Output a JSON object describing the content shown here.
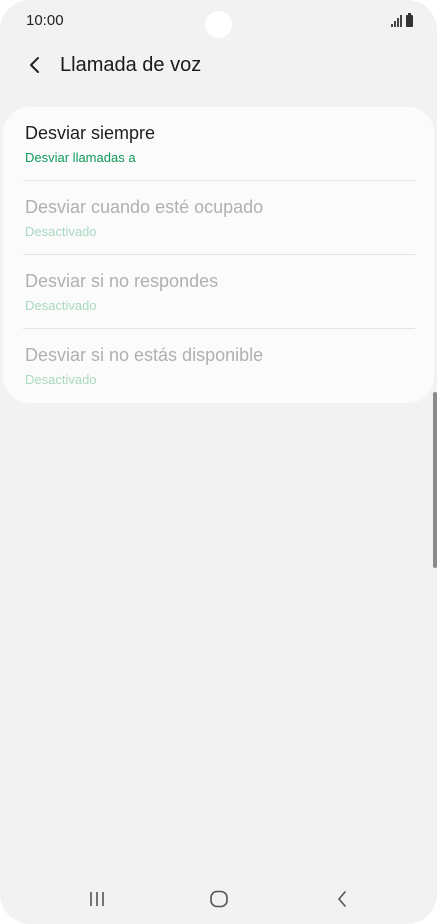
{
  "status_bar": {
    "time": "10:00",
    "icons": [
      "signal-icon",
      "battery-icon"
    ]
  },
  "header": {
    "back_icon": "chevron-left-icon",
    "title": "Llamada de voz"
  },
  "forward_options": [
    {
      "title": "Desviar siempre",
      "subtitle": "Desviar llamadas a",
      "enabled": true
    },
    {
      "title": "Desviar cuando esté ocupado",
      "subtitle": "Desactivado",
      "enabled": false
    },
    {
      "title": "Desviar si no respondes",
      "subtitle": "Desactivado",
      "enabled": false
    },
    {
      "title": "Desviar si no estás disponible",
      "subtitle": "Desactivado",
      "enabled": false
    }
  ],
  "navbar": {
    "recents_icon": "recents-icon",
    "home_icon": "home-icon",
    "back_icon": "back-icon"
  },
  "colors": {
    "accent": "#0f9a5b",
    "accent_disabled": "#a9d9bf",
    "background": "#f2f2f2",
    "card": "#fbfbfb"
  }
}
